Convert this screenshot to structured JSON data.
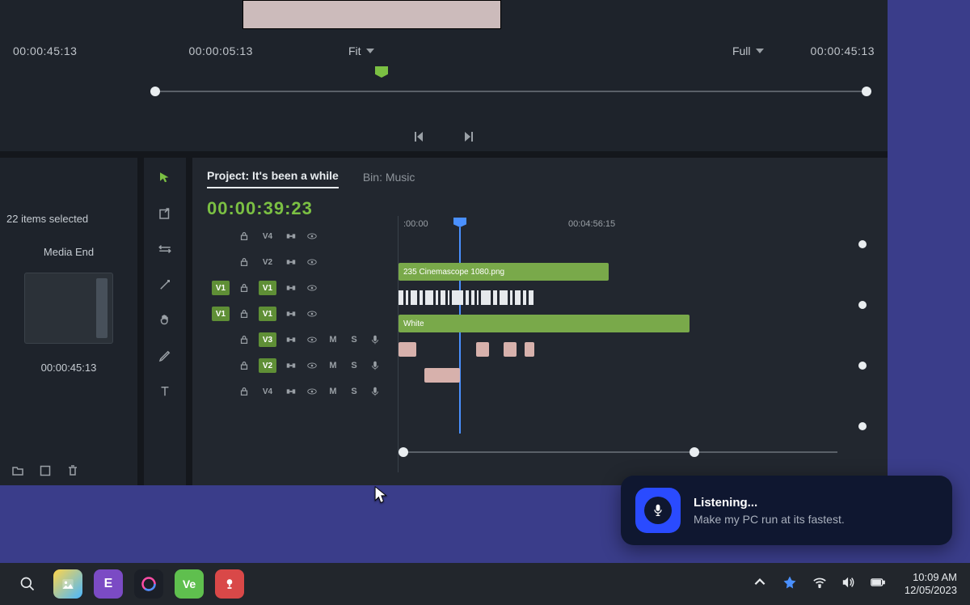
{
  "top": {
    "tc_left": "00:00:45:13",
    "tc_src": "00:00:05:13",
    "fit_label": "Fit",
    "full_label": "Full",
    "tc_right": "00:00:45:13"
  },
  "project_panel": {
    "selection_text": "22 items selected",
    "media_end_label": "Media End",
    "thumb_tc": "00:00:45:13"
  },
  "timeline": {
    "project_label": "Project: It's been a while",
    "bin_label": "Bin: Music",
    "current_tc": "00:00:39:23",
    "ruler_start": ":00:00",
    "ruler_mid": "00:04:56:15",
    "tracks": [
      {
        "label": "V4",
        "badge": false,
        "audio": false
      },
      {
        "label": "V2",
        "badge": false,
        "audio": false
      },
      {
        "label": "V1",
        "badge": true,
        "audio": false
      },
      {
        "label": "V1",
        "badge": true,
        "audio": false
      },
      {
        "label": "V3",
        "badge": false,
        "audio": true
      },
      {
        "label": "V2",
        "badge": false,
        "audio": true
      },
      {
        "label": "V4",
        "badge": false,
        "audio": true
      }
    ],
    "clip1_label": "235 Cinemascope 1080.png",
    "clip2_label": "White"
  },
  "assistant": {
    "title": "Listening...",
    "subtitle": "Make my PC run at its fastest."
  },
  "taskbar": {
    "ve_label": "Ve",
    "time": "10:09 AM",
    "date": "12/05/2023"
  }
}
